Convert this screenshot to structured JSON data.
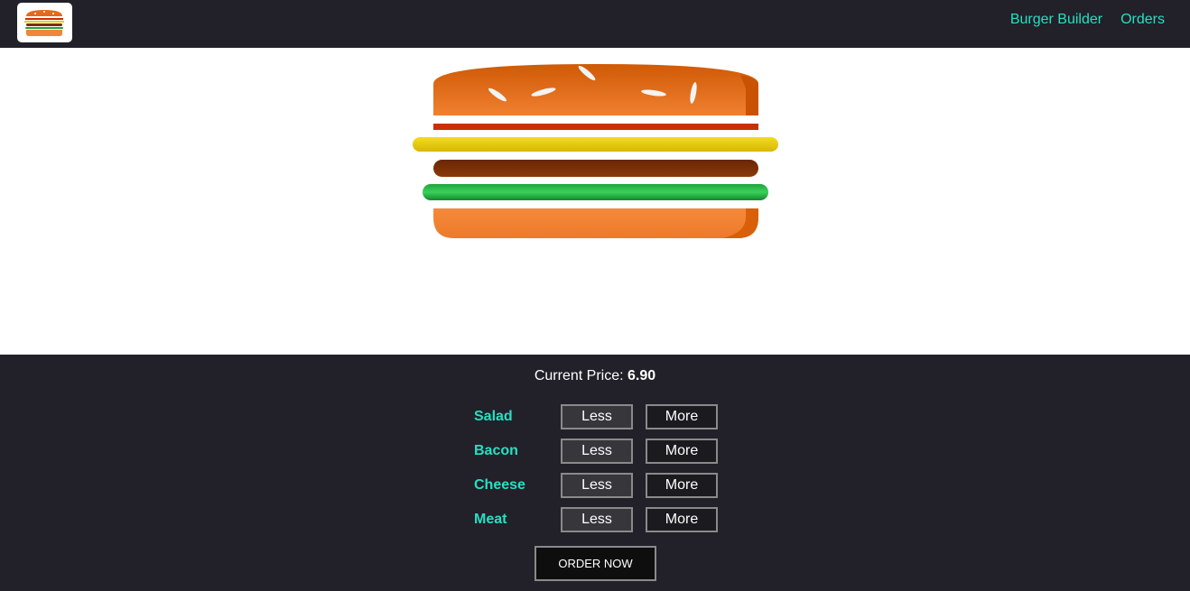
{
  "toolbar": {
    "logo_icon": "burger-logo-icon",
    "nav": [
      {
        "label": "Burger Builder"
      },
      {
        "label": "Orders"
      }
    ]
  },
  "burger": {
    "layers_top_to_bottom": [
      "bread-top",
      "bacon",
      "cheese",
      "meat",
      "salad",
      "bread-bottom"
    ],
    "colors": {
      "bread": "#e3711f",
      "bacon": "#c93000",
      "cheese": "#e8cc0a",
      "meat": "#7a2e06",
      "salad": "#1ea33c"
    }
  },
  "build_controls": {
    "price_label": "Current Price:",
    "price_value": "6.90",
    "controls": [
      {
        "label": "Salad",
        "less": "Less",
        "more": "More"
      },
      {
        "label": "Bacon",
        "less": "Less",
        "more": "More"
      },
      {
        "label": "Cheese",
        "less": "Less",
        "more": "More"
      },
      {
        "label": "Meat",
        "less": "Less",
        "more": "More"
      }
    ],
    "order_label": "ORDER NOW"
  },
  "colors": {
    "toolbar_bg": "#222029",
    "accent": "#26e0c2"
  }
}
